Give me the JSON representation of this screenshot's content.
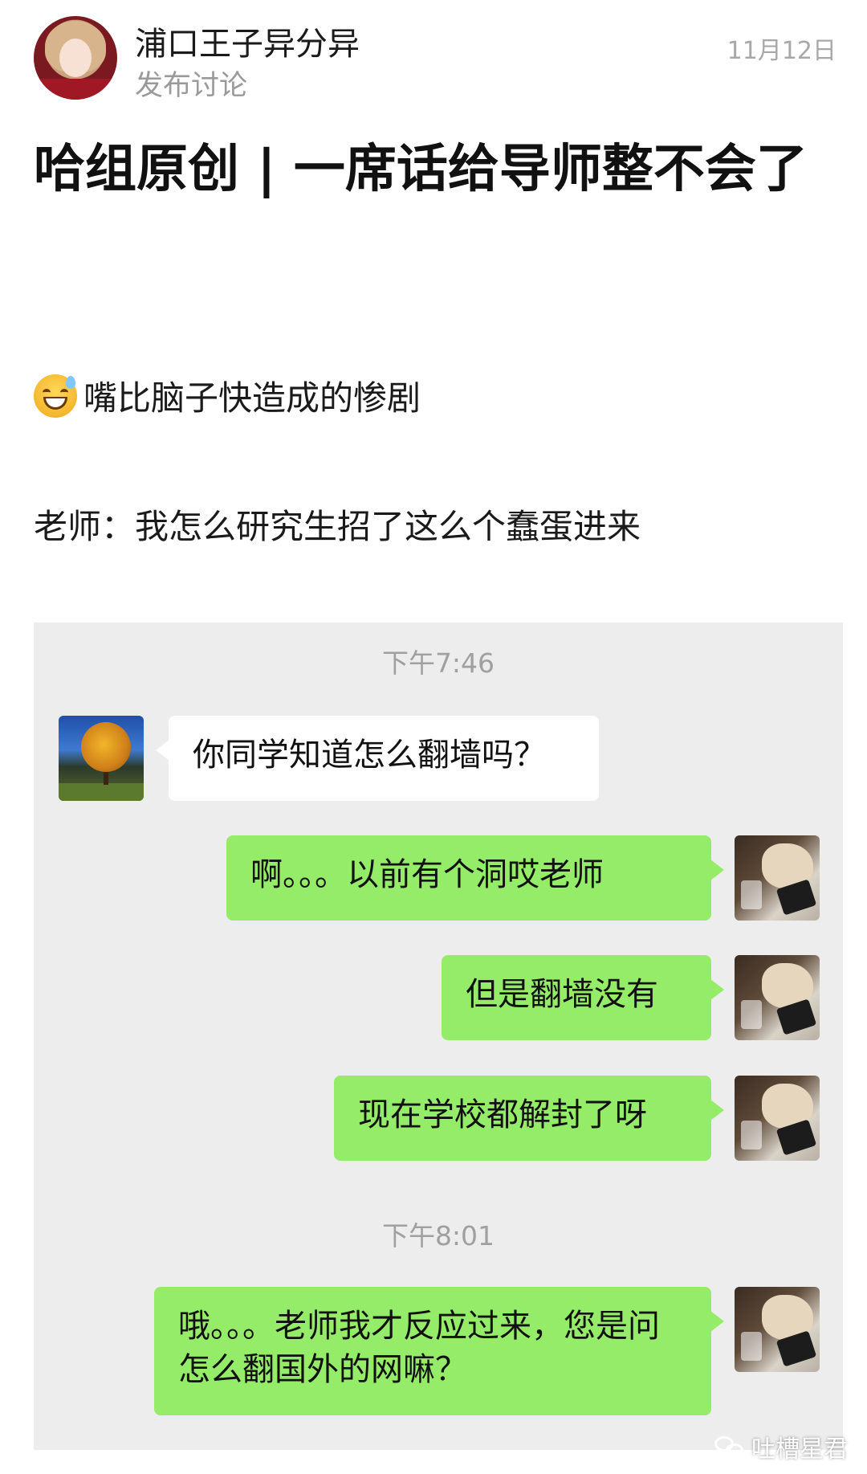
{
  "header": {
    "username": "浦口王子异分异",
    "subtitle": "发布讨论",
    "date": "11月12日"
  },
  "post": {
    "title": "哈组原创 | 一席话给导师整不会了",
    "emoji_name": "sweat-smile-icon",
    "line1": "嘴比脑子快造成的惨剧",
    "line2": "老师：我怎么研究生招了这么个蠢蛋进来"
  },
  "chat": {
    "timestamps": [
      "下午7:46",
      "下午8:01"
    ],
    "messages": [
      {
        "from": "teacher",
        "text": "你同学知道怎么翻墙吗？"
      },
      {
        "from": "me",
        "text": "啊。。。以前有个洞哎老师"
      },
      {
        "from": "me",
        "text": "但是翻墙没有"
      },
      {
        "from": "me",
        "text": "现在学校都解封了呀"
      },
      {
        "from": "me",
        "text": "哦。。。老师我才反应过来，您是问怎么翻国外的网嘛？"
      }
    ]
  },
  "watermark": {
    "icon": "wechat-icon",
    "text": "吐槽星君"
  },
  "colors": {
    "chat_bg": "#ededed",
    "bubble_out": "#95ec69",
    "bubble_in": "#ffffff"
  }
}
